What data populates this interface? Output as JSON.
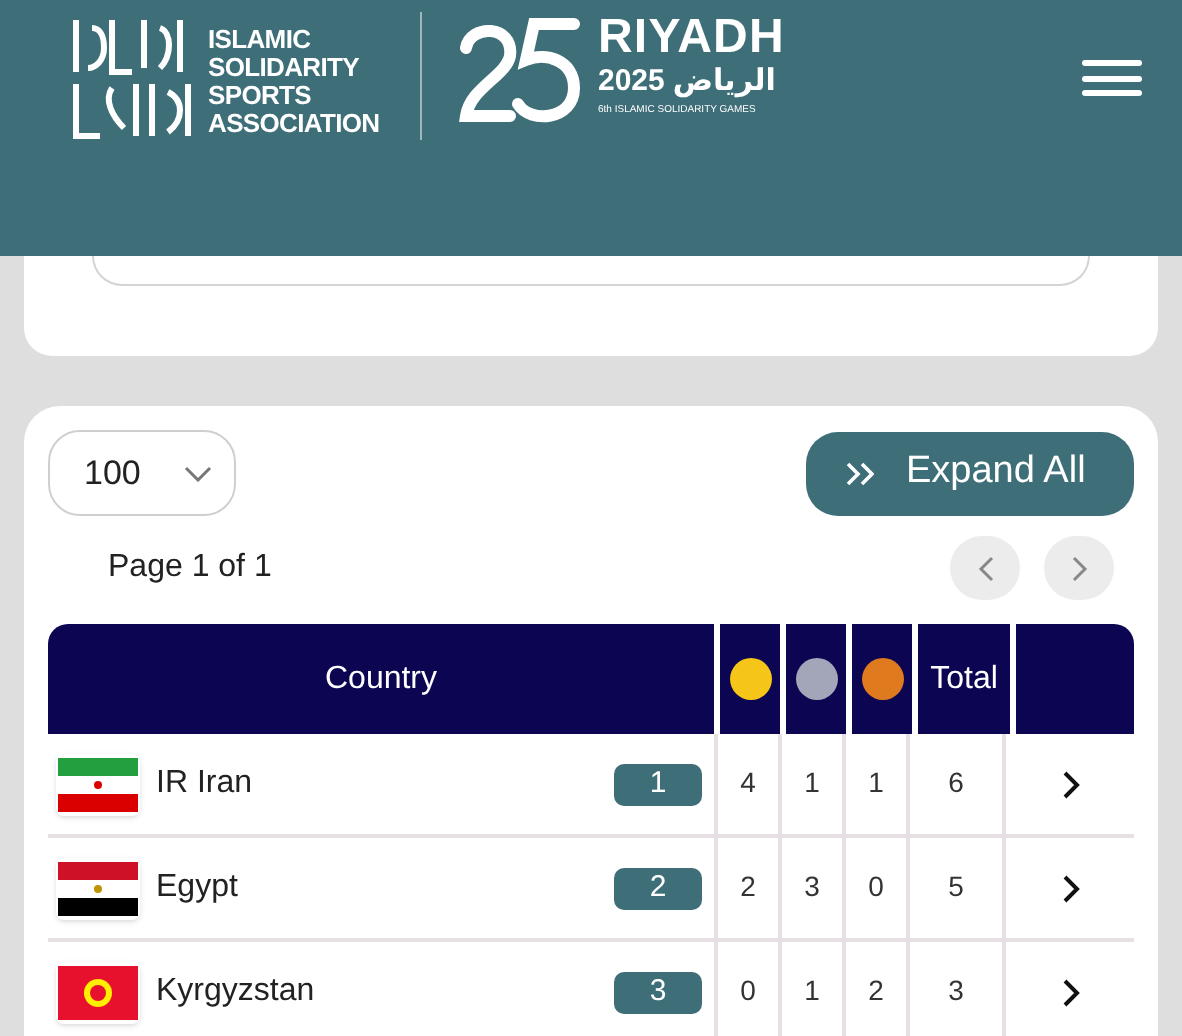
{
  "header": {
    "org_name": "ISLAMIC SOLIDARITY SPORTS ASSOCIATION",
    "games_title": "RIYADH",
    "games_year": "2025",
    "games_arabic": "الرياض",
    "games_subtitle": "6th ISLAMIC SOLIDARITY GAMES"
  },
  "page_size": {
    "value": "100"
  },
  "expand_button": {
    "label": "Expand All"
  },
  "pagination": {
    "label": "Page 1 of 1"
  },
  "table": {
    "columns": [
      {
        "kind": "text",
        "label": "Country"
      },
      {
        "kind": "medal",
        "color": "#f5c518"
      },
      {
        "kind": "medal",
        "color": "#a3a6b8"
      },
      {
        "kind": "medal",
        "color": "#e07a1f"
      },
      {
        "kind": "text",
        "label": "Total"
      }
    ],
    "rows": [
      {
        "country": "IR Iran",
        "kind": "iran",
        "rank": "1",
        "gold": "4",
        "silver": "1",
        "bronze": "1",
        "total": "6"
      },
      {
        "country": "Egypt",
        "kind": "egypt",
        "rank": "2",
        "gold": "2",
        "silver": "3",
        "bronze": "0",
        "total": "5"
      },
      {
        "country": "Kyrgyzstan",
        "kind": "kyrgyzstan",
        "rank": "3",
        "gold": "0",
        "silver": "1",
        "bronze": "2",
        "total": "3"
      }
    ]
  }
}
